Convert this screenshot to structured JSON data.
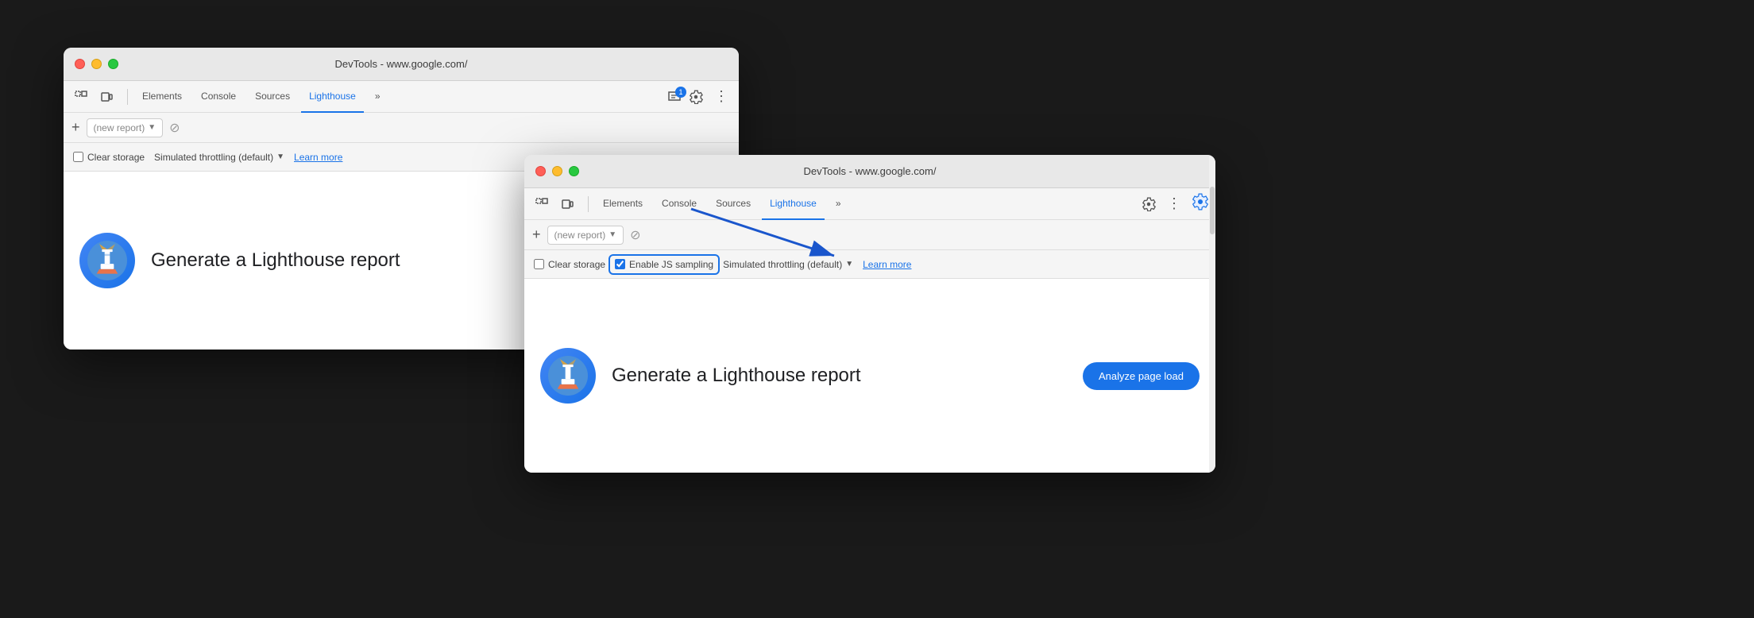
{
  "back_window": {
    "title": "DevTools - www.google.com/",
    "tabs": [
      {
        "label": "Elements",
        "active": false
      },
      {
        "label": "Console",
        "active": false
      },
      {
        "label": "Sources",
        "active": false
      },
      {
        "label": "Lighthouse",
        "active": true
      },
      {
        "label": "»",
        "active": false
      }
    ],
    "secondary": {
      "placeholder": "(new report)"
    },
    "options": {
      "clear_storage_label": "Clear storage",
      "throttling_label": "Simulated throttling (default)",
      "learn_more": "Learn more"
    },
    "main": {
      "generate_label": "Generate a Lighthouse report",
      "logo_alt": "Lighthouse logo"
    },
    "badges": {
      "message_count": "1"
    }
  },
  "front_window": {
    "title": "DevTools - www.google.com/",
    "tabs": [
      {
        "label": "Elements",
        "active": false
      },
      {
        "label": "Console",
        "active": false
      },
      {
        "label": "Sources",
        "active": false
      },
      {
        "label": "Lighthouse",
        "active": true
      },
      {
        "label": "»",
        "active": false
      }
    ],
    "secondary": {
      "placeholder": "(new report)"
    },
    "options": {
      "clear_storage_label": "Clear storage",
      "enable_js_label": "Enable JS sampling",
      "throttling_label": "Simulated throttling (default)",
      "learn_more": "Learn more"
    },
    "main": {
      "generate_label": "Generate a Lighthouse report",
      "analyze_label": "Analyze page load",
      "logo_alt": "Lighthouse logo"
    }
  },
  "colors": {
    "active_tab": "#1a73e8",
    "analyze_btn": "#1a73e8",
    "arrow": "#1a56cc"
  }
}
